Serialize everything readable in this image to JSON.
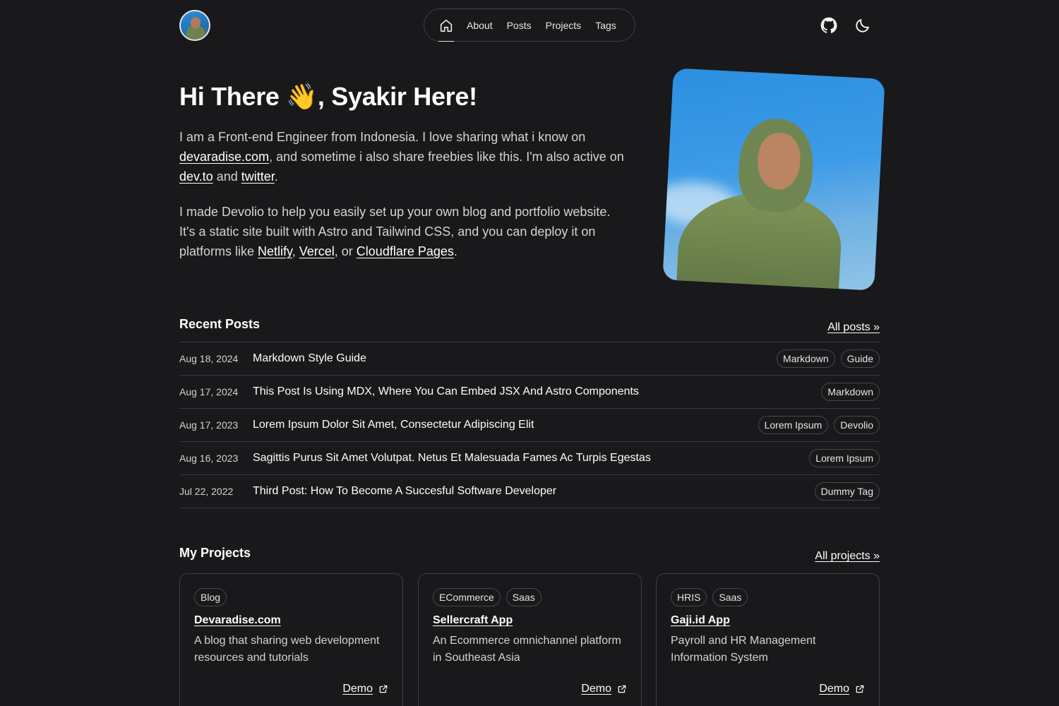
{
  "nav": {
    "items": [
      "About",
      "Posts",
      "Projects",
      "Tags"
    ]
  },
  "hero": {
    "title": "Hi There 👋, Syakir Here!",
    "p1": {
      "t1": "I am a Front-end Engineer from Indonesia. I love sharing what i know on ",
      "link1": "devaradise.com",
      "t2": ", and sometime i also share freebies like this. I'm also active on ",
      "link2": "dev.to",
      "t3": " and ",
      "link3": "twitter",
      "t4": "."
    },
    "p2": {
      "t1": "I made Devolio to help you easily set up your own blog and portfolio website. It's a static site built with Astro and Tailwind CSS, and you can deploy it on platforms like ",
      "link1": "Netlify",
      "t2": ", ",
      "link2": "Vercel",
      "t3": ", or ",
      "link3": "Cloudflare Pages",
      "t4": "."
    }
  },
  "recent_posts": {
    "title": "Recent Posts",
    "all_link": "All posts »",
    "posts": [
      {
        "date": "Aug 18, 2024",
        "title": "Markdown Style Guide",
        "tags": [
          "Markdown",
          "Guide"
        ]
      },
      {
        "date": "Aug 17, 2024",
        "title": "This Post Is Using MDX, Where You Can Embed JSX And Astro Components",
        "tags": [
          "Markdown"
        ]
      },
      {
        "date": "Aug 17, 2023",
        "title": "Lorem Ipsum Dolor Sit Amet, Consectetur Adipiscing Elit",
        "tags": [
          "Lorem Ipsum",
          "Devolio"
        ]
      },
      {
        "date": "Aug 16, 2023",
        "title": "Sagittis Purus Sit Amet Volutpat. Netus Et Malesuada Fames Ac Turpis Egestas",
        "tags": [
          "Lorem Ipsum"
        ]
      },
      {
        "date": "Jul 22, 2022",
        "title": "Third Post: How To Become A Succesful Software Developer",
        "tags": [
          "Dummy Tag"
        ]
      }
    ]
  },
  "projects": {
    "title": "My Projects",
    "all_link": "All projects »",
    "items": [
      {
        "tags": [
          "Blog"
        ],
        "title": "Devaradise.com",
        "desc": "A blog that sharing web development resources and tutorials",
        "demo": "Demo"
      },
      {
        "tags": [
          "ECommerce",
          "Saas"
        ],
        "title": "Sellercraft App",
        "desc": "An Ecommerce omnichannel platform in Southeast Asia",
        "demo": "Demo"
      },
      {
        "tags": [
          "HRIS",
          "Saas"
        ],
        "title": "Gaji.id App",
        "desc": "Payroll and HR Management Information System",
        "demo": "Demo"
      }
    ]
  }
}
